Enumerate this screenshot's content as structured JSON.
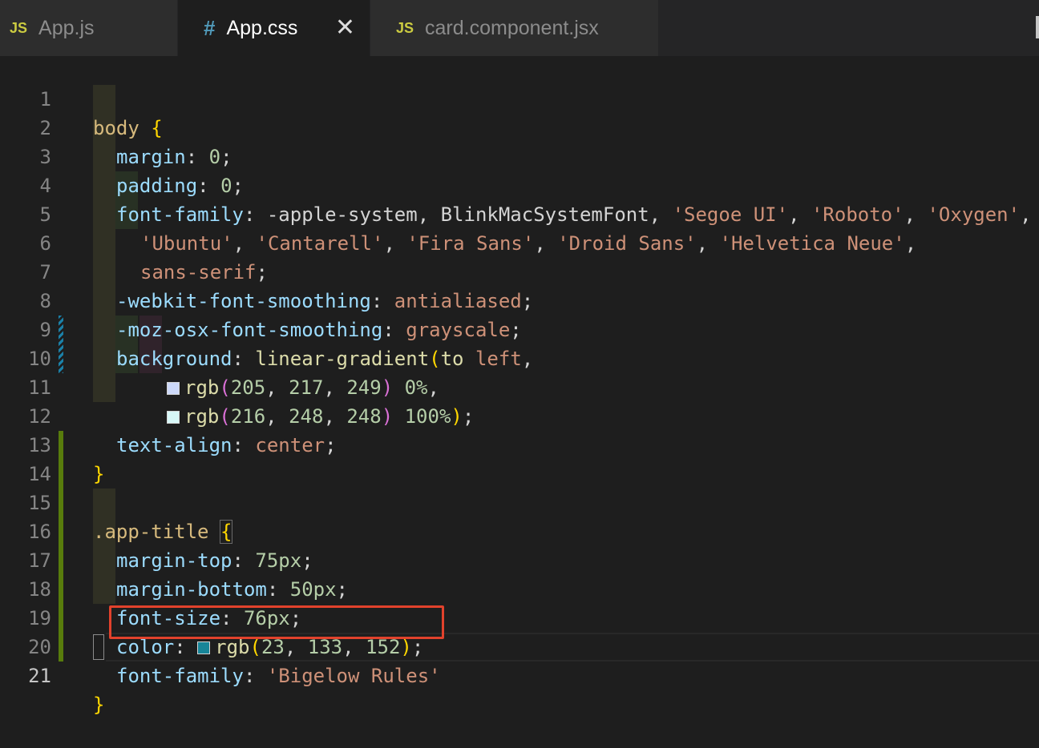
{
  "tabs": [
    {
      "icon": "JS",
      "label": "App.js"
    },
    {
      "icon": "#",
      "label": "App.css"
    },
    {
      "icon": "JS",
      "label": "card.component.jsx"
    }
  ],
  "line_numbers": [
    "1",
    "2",
    "3",
    "4",
    "5",
    "6",
    "7",
    "8",
    "9",
    "10",
    "11",
    "12",
    "13",
    "14",
    "15",
    "16",
    "17",
    "18",
    "19",
    "20",
    "21"
  ],
  "code": {
    "l1_sel": "body",
    "l1_brace": " {",
    "l2_prop": "margin",
    "l2_val": "0",
    "l3_prop": "padding",
    "l3_val": "0",
    "l4_prop": "font-family",
    "l4_plain": " -apple-system, BlinkMacSystemFont, ",
    "l4_s1": "'Segoe UI'",
    "l4_s2": "'Roboto'",
    "l4_s3": "'Oxygen'",
    "l5_s1": "'Ubuntu'",
    "l5_s2": "'Cantarell'",
    "l5_s3": "'Fira Sans'",
    "l5_s4": "'Droid Sans'",
    "l5_s5": "'Helvetica Neue'",
    "l6_val": "sans-serif",
    "l7_prop": "-webkit-font-smoothing",
    "l7_val": "antialiased",
    "l8_prop": "-moz-osx-font-smoothing",
    "l8_val": "grayscale",
    "l9_prop": "background",
    "l9_fn": "linear-gradient",
    "l9_to": "to",
    "l9_left": "left",
    "l10_fn": "rgb",
    "l10_nums": [
      "205",
      "217",
      "249"
    ],
    "l10_pct": "0%",
    "l11_fn": "rgb",
    "l11_nums": [
      "216",
      "248",
      "248"
    ],
    "l11_pct": "100%",
    "l12_prop": "text-align",
    "l12_val": "center",
    "l13_close": "}",
    "l15_sel": ".app-title",
    "l16_prop": "margin-top",
    "l16_val": "75px",
    "l17_prop": "margin-bottom",
    "l17_val": "50px",
    "l18_prop": "font-size",
    "l18_val": "76px",
    "l19_prop": "color",
    "l19_fn": "rgb",
    "l19_nums": [
      "23",
      "133",
      "152"
    ],
    "l20_prop": "font-family",
    "l20_val": "'Bigelow Rules'",
    "l21_close": "}"
  },
  "swatches": {
    "l10": "#cdd9f9",
    "l11": "#d8f8f8",
    "l19": "#178598"
  }
}
